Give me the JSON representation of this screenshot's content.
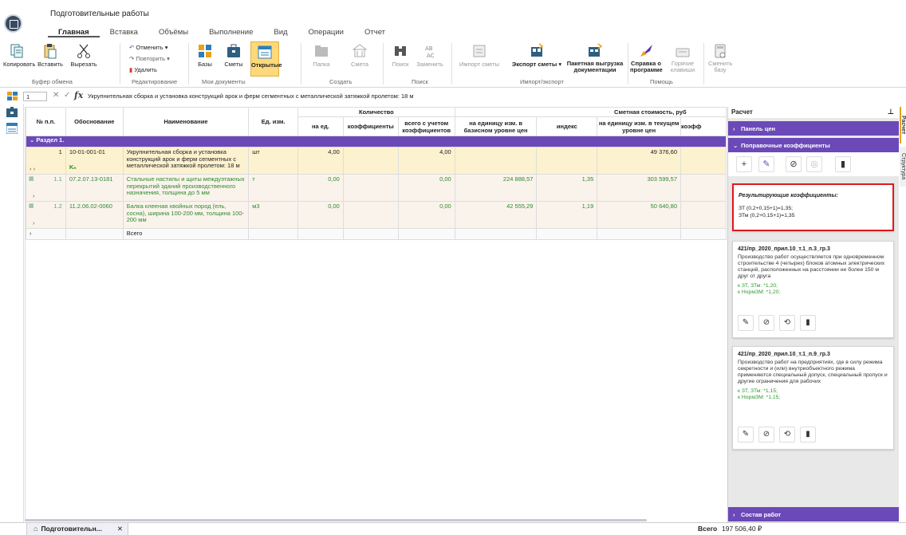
{
  "window": {
    "title": "Подготовительные работы"
  },
  "tabs": [
    "Главная",
    "Вставка",
    "Объёмы",
    "Выполнение",
    "Вид",
    "Операции",
    "Отчет"
  ],
  "ribbon": {
    "copy": "Копировать",
    "paste": "Вставить",
    "cut": "Вырезать",
    "buffer_group": "Буфер обмена",
    "undo": "Отменить",
    "redo": "Повторить",
    "delete": "Удалить",
    "edit_group": "Редактирование",
    "bases": "Базы",
    "estimates": "Сметы",
    "opened": "Открытые",
    "docs_group": "Мои документы",
    "folder": "Папка",
    "estimate": "Смета",
    "create_group": "Создать",
    "search": "Поиск",
    "replace": "Заменить",
    "search_group": "Поиск",
    "import_estimate": "Импорт сметы",
    "export_estimates": "Экспорт сметы",
    "batch_export": "Пакетная выгрузка документации",
    "io_group": "Импорт/экспорт",
    "about": "Справка о программе",
    "hotkeys": "Горячие клавиши",
    "help_group": "Помощь",
    "change_base": "Сменить базу"
  },
  "formula_bar": {
    "cell": "1",
    "fx": "fx",
    "text": "Укрупнительная сборка и установка конструкций арок и ферм сегментных с металлической затяжкой пролетом: 18 м"
  },
  "grid": {
    "headers": {
      "num": "№ п.п.",
      "basis": "Обоснование",
      "name": "Наименование",
      "unit": "Ед. изм.",
      "qty": "Количество",
      "per_unit": "на ед.",
      "coefs": "коэффициенты",
      "total_coef": "всего с учетом коэффициентов",
      "cost": "Сметная стоимость, руб",
      "base_price": "на единицу изм. в базисном уровне цен",
      "index": "индекс",
      "current_price": "на единицу изм. в текущем уровне цен",
      "coef_cut": "коэфф"
    },
    "section": "Раздел 1.",
    "rows": [
      {
        "num": "1",
        "basis": "10-01-001-01",
        "k": "Kₙ",
        "name": "Укрупнительная сборка и установка конструкций арок и ферм сегментных с металлической затяжкой пролетом: 18 м",
        "unit": "шт",
        "per_unit": "4,00",
        "total": "4,00",
        "base": "",
        "index": "",
        "current": "49 376,60"
      },
      {
        "num": "1.1",
        "basis": "07.2.07.13-0181",
        "name": "Стальные настилы и щиты междуэтажных перекрытий зданий производственного назначения, толщина до 5 мм",
        "unit": "т",
        "per_unit": "0,00",
        "total": "0,00",
        "base": "224 888,57",
        "index": "1,35",
        "current": "303 599,57"
      },
      {
        "num": "1.2",
        "basis": "11.2.06.02-0060",
        "name": "Балка клееная хвойных пород (ель, сосна), ширина 100-200 мм, толщина 100-200 мм",
        "unit": "м3",
        "per_unit": "0,00",
        "total": "0,00",
        "base": "42 555,29",
        "index": "1,19",
        "current": "50 640,80"
      }
    ],
    "total_label": "Всего"
  },
  "panel": {
    "title": "Расчет",
    "price_panel": "Панель цен",
    "corrections": "Поправочные коэффициенты",
    "result_title": "Результирующие коэффициенты:",
    "result_lines": [
      "ЗТ (0,2+0,15+1)=1,35;",
      "ЗТм (0,2+0,15+1)=1,35"
    ],
    "cards": [
      {
        "title": "421/пр_2020_прил.10_т.1_п.3_гр.3",
        "text": "Производство работ осуществляется при одновременном строительстве 4 (четырех) блоков атомных электрических станций, расположенных на расстоянии не более 150 м друг от друга",
        "green1": "к ЗТ, ЗТм: *1,20;",
        "green2": "к НормЗМ: *1,20;"
      },
      {
        "title": "421/пр_2020_прил.10_т.1_п.9_гр.3",
        "text": "Производство работ на предприятиях, где в силу режима секретности и (или) внутриобъектного режима применяются специальный допуск, специальный пропуск и другие ограничения для рабочих",
        "green1": "к ЗТ, ЗТм: *1,15;",
        "green2": "к НормЗМ: *1,15;"
      }
    ],
    "works": "Состав работ",
    "side_tab_1": "Расчет",
    "side_tab_2": "Структура"
  },
  "bottom": {
    "tab": "Подготовительн...",
    "total_label": "Всего",
    "total_value": "197 506,40 ₽"
  }
}
